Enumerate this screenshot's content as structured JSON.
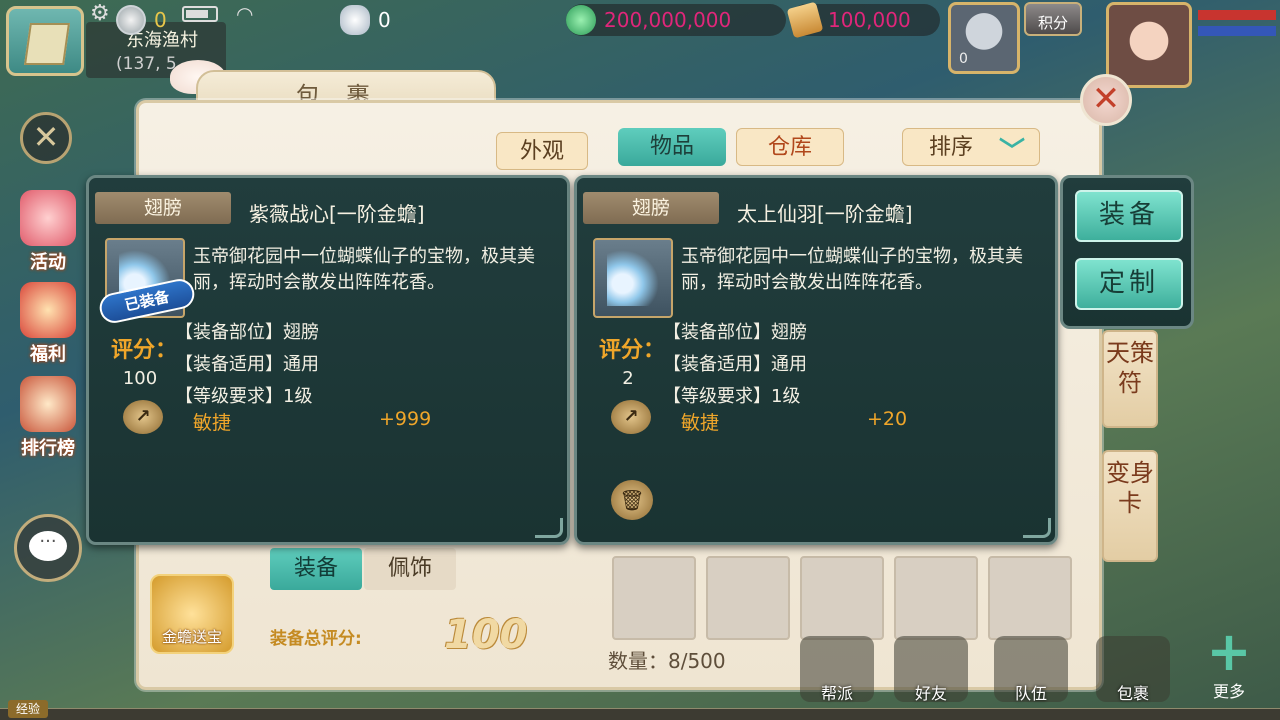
{
  "hud": {
    "location_name": "东海渔村",
    "location_coord": "(137, 5",
    "gold_ingot": "0",
    "silver": "0",
    "jade_coins": "200,000,000",
    "tickets": "100,000",
    "jifen_label": "积分",
    "hero_level": "0",
    "colors": {
      "jade": "#e0267a",
      "tickets": "#e0267a",
      "gold": "#e8c64a",
      "silver": "#ffffff"
    }
  },
  "left_menu": [
    {
      "label": "活动",
      "icon": "horn-icon"
    },
    {
      "label": "福利",
      "icon": "gift-icon"
    },
    {
      "label": "排行榜",
      "icon": "ranking-icon"
    }
  ],
  "bag": {
    "title": "包裹",
    "tabs": {
      "outer": "外观",
      "items": "物品",
      "storage": "仓库",
      "sort": "排序"
    },
    "equip_tabs": {
      "equip": "装备",
      "accessory": "佩饰"
    },
    "total_score_label": "装备总评分:",
    "total_score": "100",
    "jinchan_label": "金蟾送宝",
    "count_text": "数量：8/500",
    "side_tabs": [
      "天策符",
      "变身卡"
    ]
  },
  "equipped_card": {
    "category": "翅膀",
    "name": "紫薇战心[一阶金蟾]",
    "badge": "已装备",
    "score_label": "评分：",
    "score": "100",
    "description": "玉帝御花园中一位蝴蝶仙子的宝物，极其美丽，挥动时会散发出阵阵花香。",
    "attrs": [
      "【装备部位】翅膀",
      "【装备适用】通用",
      "【等级要求】1级"
    ],
    "stat_name": "敏捷",
    "stat_value": "+999"
  },
  "item_card": {
    "category": "翅膀",
    "name": "太上仙羽[一阶金蟾]",
    "score_label": "评分：",
    "score": "2",
    "description": "玉帝御花园中一位蝴蝶仙子的宝物，极其美丽，挥动时会散发出阵阵花香。",
    "attrs": [
      "【装备部位】翅膀",
      "【装备适用】通用",
      "【等级要求】1级"
    ],
    "stat_name": "敏捷",
    "stat_value": "+20"
  },
  "actions": {
    "equip": "装备",
    "customize": "定制"
  },
  "bottom_bar": {
    "exp_label": "经验",
    "buttons": [
      "帮派",
      "好友",
      "队伍",
      "包裹"
    ],
    "more": "更多"
  }
}
